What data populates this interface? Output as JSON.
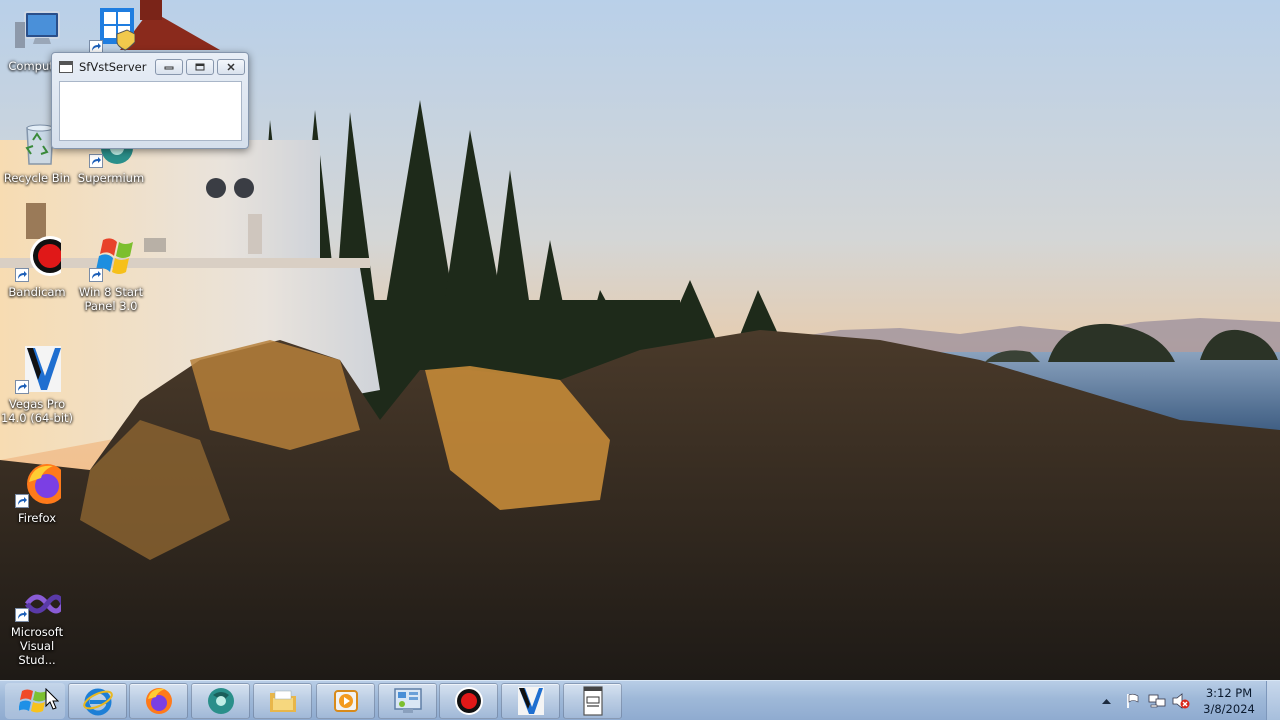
{
  "desktop": {
    "icons": [
      {
        "label": "Computer",
        "icon": "computer-icon"
      },
      {
        "label": "",
        "icon": "windows-shield-icon"
      },
      {
        "label": "Recycle Bin",
        "icon": "recycle-bin-icon"
      },
      {
        "label": "Supermium",
        "icon": "supermium-icon"
      },
      {
        "label": "Bandicam",
        "icon": "bandicam-icon"
      },
      {
        "label": "Win 8 Start Panel 3.0",
        "icon": "windows-logo-icon"
      },
      {
        "label": "Vegas Pro 14.0 (64-bit)",
        "icon": "vegas-pro-icon"
      },
      {
        "label": "Firefox",
        "icon": "firefox-icon"
      },
      {
        "label": "Microsoft Visual Stud...",
        "icon": "visual-studio-icon"
      }
    ]
  },
  "window": {
    "title": "SfVstServer",
    "buttons": [
      "minimize",
      "maximize",
      "close"
    ]
  },
  "taskbar": {
    "start_icon": "windows-orb-icon",
    "pinned": [
      {
        "icon": "internet-explorer-icon"
      },
      {
        "icon": "firefox-icon"
      },
      {
        "icon": "supermium-icon"
      },
      {
        "icon": "file-explorer-icon"
      },
      {
        "icon": "media-player-icon"
      },
      {
        "icon": "control-panel-icon"
      },
      {
        "icon": "bandicam-icon"
      },
      {
        "icon": "vegas-pro-icon"
      },
      {
        "icon": "sfvstserver-icon"
      }
    ],
    "tray": [
      "show-hidden-icons-icon",
      "action-center-flag-icon",
      "network-icon",
      "volume-muted-icon"
    ],
    "clock": {
      "time": "3:12 PM",
      "date": "3/8/2024"
    }
  },
  "colors": {
    "taskbar": "#9eb8d8",
    "sky_top": "#bcd3ea",
    "sky_bottom": "#f4b57a",
    "sea": "#4e6f93"
  }
}
